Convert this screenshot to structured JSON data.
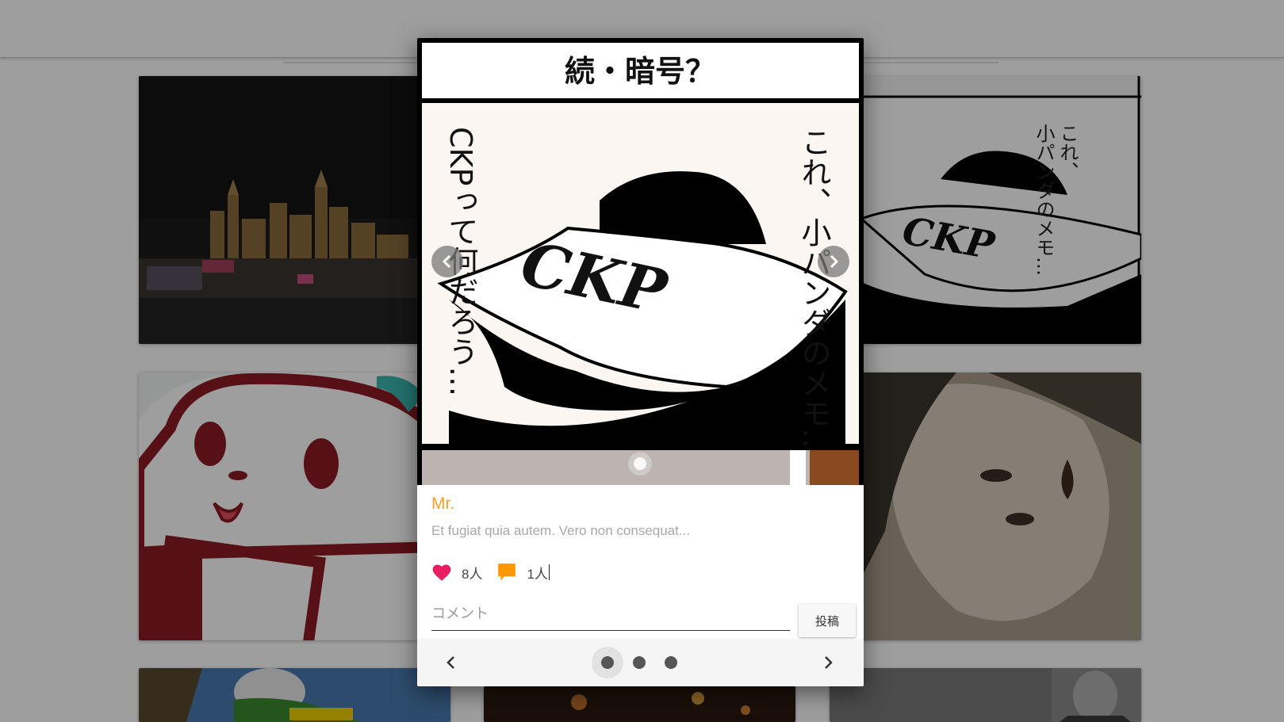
{
  "gallery": {
    "tiles": [
      "city-night-photo",
      "panda-illustration",
      "comic-panel",
      "portrait-photo",
      "cyclist-photo",
      "street-lights-photo",
      "street-photo"
    ]
  },
  "comic": {
    "title": "続・暗号？",
    "speech_right": "これ、小パンダのメモ…",
    "speech_left": "CKPって何だろう…",
    "note_text": "CKP"
  },
  "post": {
    "author": "Mr.",
    "description": "Et fugiat quia autem. Vero non consequat...",
    "likes": "8人",
    "comments": "1人"
  },
  "comment_form": {
    "placeholder": "コメント",
    "submit_label": "投稿"
  },
  "pager": {
    "total": 3,
    "active": 1
  },
  "colors": {
    "accent": "#f5a12a",
    "heart": "#e91e63",
    "comment_icon": "#ff9800"
  }
}
